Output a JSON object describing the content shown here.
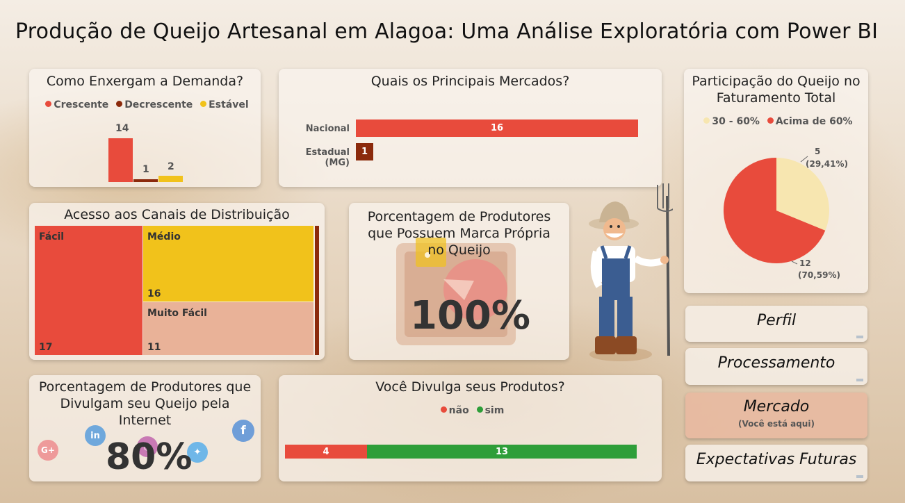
{
  "header": {
    "title": "Produção de Queijo Artesanal em Alagoa: Uma Análise Exploratória com Power BI"
  },
  "demand": {
    "title": "Como Enxergam a Demanda?",
    "legend": [
      "Crescente",
      "Decrescente",
      "Estável"
    ],
    "colors": [
      "#e84b3c",
      "#8b2a0c",
      "#f1c21b"
    ],
    "values": [
      "14",
      "1",
      "2"
    ]
  },
  "markets": {
    "title": "Quais os Principais Mercados?",
    "rows": [
      {
        "label": "Nacional",
        "value": "16"
      },
      {
        "label": "Estadual (MG)",
        "value": "1"
      }
    ]
  },
  "revenue": {
    "title": "Participação do Queijo no Faturamento Total",
    "legend": [
      "30 - 60%",
      "Acima de 60%"
    ],
    "colors": [
      "#f7e6b0",
      "#e84b3c"
    ],
    "slices": [
      {
        "count": "5",
        "pct": "(29,41%)"
      },
      {
        "count": "12",
        "pct": "(70,59%)"
      }
    ]
  },
  "distribution": {
    "title": "Acesso aos Canais de Distribuição",
    "cells": [
      {
        "name": "Fácil",
        "value": "17"
      },
      {
        "name": "Médio",
        "value": "16"
      },
      {
        "name": "Muito Fácil",
        "value": "11"
      }
    ]
  },
  "brand": {
    "title": "Porcentagem de Produtores que Possuem Marca Própria no Queijo",
    "value": "100%"
  },
  "internet": {
    "title": "Porcentagem de Produtores que Divulgam seu Queijo pela Internet",
    "value": "80%",
    "icons": [
      "G+",
      "in",
      "f"
    ]
  },
  "promote": {
    "title": "Você Divulga seus Produtos?",
    "legend": [
      "não",
      "sim"
    ],
    "colors": [
      "#e84b3c",
      "#2e9e39"
    ],
    "values": [
      "4",
      "13"
    ]
  },
  "nav": {
    "perfil": "Perfil",
    "processamento": "Processamento",
    "mercado": "Mercado",
    "mercado_sub": "(Você está aqui)",
    "expectativas": "Expectativas Futuras"
  },
  "chart_data": [
    {
      "type": "bar",
      "title": "Como Enxergam a Demanda?",
      "categories": [
        "Crescente",
        "Decrescente",
        "Estável"
      ],
      "values": [
        14,
        1,
        2
      ]
    },
    {
      "type": "bar",
      "title": "Quais os Principais Mercados?",
      "categories": [
        "Nacional",
        "Estadual (MG)"
      ],
      "values": [
        16,
        1
      ]
    },
    {
      "type": "pie",
      "title": "Participação do Queijo no Faturamento Total",
      "categories": [
        "30 - 60%",
        "Acima de 60%"
      ],
      "values": [
        5,
        12
      ]
    },
    {
      "type": "bar",
      "title": "Acesso aos Canais de Distribuição",
      "categories": [
        "Fácil",
        "Médio",
        "Muito Fácil"
      ],
      "values": [
        17,
        16,
        11
      ]
    },
    {
      "type": "bar",
      "title": "Você Divulga seus Produtos?",
      "categories": [
        "não",
        "sim"
      ],
      "values": [
        4,
        13
      ]
    }
  ]
}
